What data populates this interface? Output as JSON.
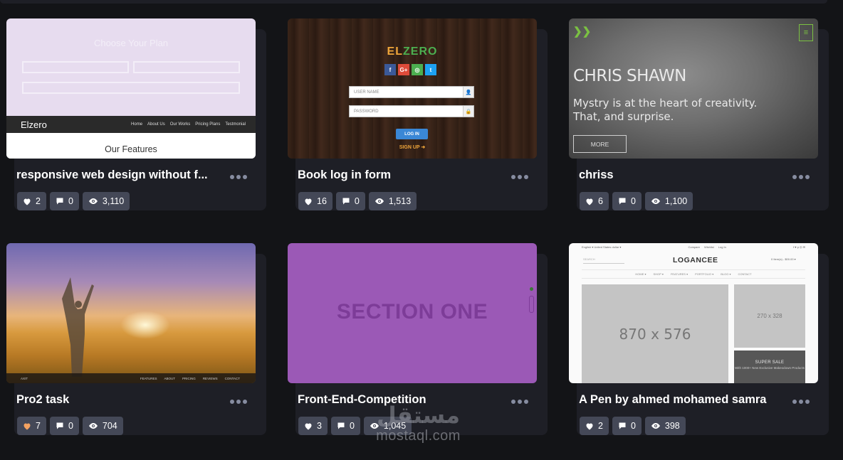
{
  "cards": [
    {
      "title": "responsive web design without f...",
      "likes": "2",
      "comments": "0",
      "views": "3,110",
      "liked": false,
      "thumb": {
        "plan_title": "Choose Your Plan",
        "brand": "Elzero",
        "nav": [
          "Home",
          "About Us",
          "Our Works",
          "Pricing Plans",
          "Testmonial"
        ],
        "section": "Our Features"
      }
    },
    {
      "title": "Book log in form",
      "likes": "16",
      "comments": "0",
      "views": "1,513",
      "liked": false,
      "thumb": {
        "logo_a": "EL",
        "logo_b": "ZERO",
        "social": [
          "f",
          "G+",
          "◎",
          "t"
        ],
        "username": "USER NAME",
        "password": "PASSWORD",
        "login": "LOG IN",
        "signup": "SIGN UP ➜"
      }
    },
    {
      "title": "chriss",
      "likes": "6",
      "comments": "0",
      "views": "1,100",
      "liked": false,
      "thumb": {
        "name": "CHRIS SHAWN",
        "line1": "Mystry is at the heart of creativity.",
        "line2": "That, and surprise.",
        "more": "MORE",
        "menu": "≡"
      }
    },
    {
      "title": "Pro2 task",
      "likes": "7",
      "comments": "0",
      "views": "704",
      "liked": true,
      "thumb": {
        "brand": "AXIT",
        "nav": [
          "FEATURES",
          "ABOUT",
          "PRICING",
          "REVIEWS",
          "CONTACT"
        ]
      }
    },
    {
      "title": "Front-End-Competition",
      "likes": "3",
      "comments": "0",
      "views": "1,045",
      "liked": false,
      "thumb": {
        "section": "SECTION ONE"
      }
    },
    {
      "title": "A Pen by ahmed mohamed samra",
      "likes": "2",
      "comments": "0",
      "views": "398",
      "liked": false,
      "thumb": {
        "top_left": "English ▾   United States dollar ▾",
        "top_mid": [
          "Compare",
          "Wishlist",
          "Log In"
        ],
        "top_right": "f ♥ p ◎ ✉",
        "logo": "LOGANCEE",
        "search": "SEARCH",
        "cart": "0 Item(s) - $00.00 ▾",
        "nav": [
          "HOME ▾",
          "SHOP ▾",
          "FEATURES ▾",
          "PORTFOLIO ▾",
          "BLOG ▾",
          "CONTACT"
        ],
        "big_size": "870 x 576",
        "small_size": "270 x 328",
        "sale_title": "SUPER SALE",
        "sale_text": "With 1000+ New Exclusive Makeodown Products"
      }
    }
  ],
  "watermark": {
    "arabic": "مستقل",
    "latin": "mostaql.com"
  },
  "colors": {
    "page_bg": "#131417",
    "card_bg": "#1e1f26",
    "pill_bg": "#444857",
    "liked_heart": "#f4a261"
  }
}
